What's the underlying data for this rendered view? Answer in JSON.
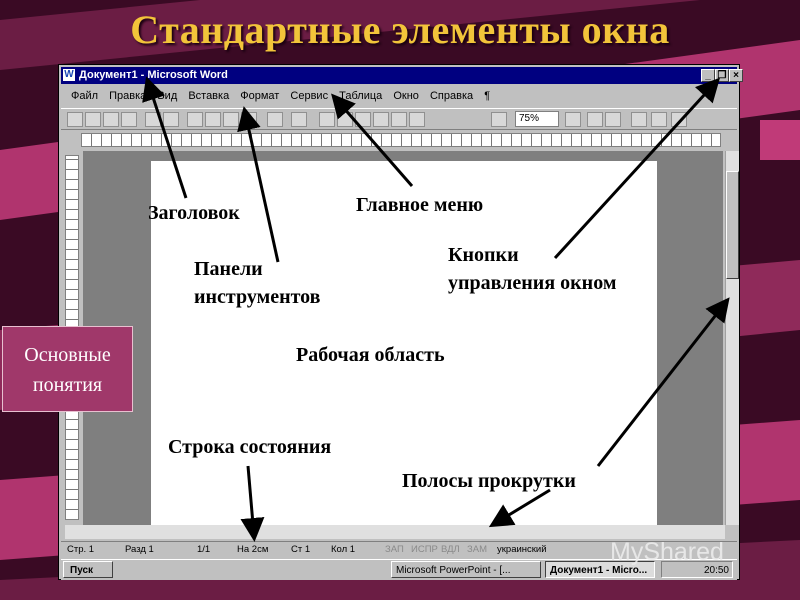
{
  "slide": {
    "title": "Стандартные элементы окна",
    "concepts_button": "Основные понятия",
    "watermark": "MyShared"
  },
  "window": {
    "title": "Документ1 - Microsoft Word",
    "app_icon": "W",
    "controls": [
      "minimize-icon",
      "restore-icon",
      "close-icon"
    ],
    "menu": [
      "Файл",
      "Правка",
      "Вид",
      "Вставка",
      "Формат",
      "Сервис",
      "Таблица",
      "Окно",
      "Справка"
    ],
    "zoom": "75%"
  },
  "statusbar": {
    "page": "Стр. 1",
    "section": "Разд 1",
    "pages": "1/1",
    "at": "На 2см",
    "line": "Ст 1",
    "col": "Кол 1",
    "modes": [
      "ЗАП",
      "ИСПР",
      "ВДЛ",
      "ЗАМ"
    ],
    "language": "украинский"
  },
  "taskbar": {
    "start": "Пуск",
    "tasks": [
      "Microsoft PowerPoint - [...",
      "Документ1 - Micro..."
    ],
    "clock": "20:50"
  },
  "labels": {
    "title_bar": "Заголовок",
    "main_menu": "Главное меню",
    "toolbars_1": "Панели",
    "toolbars_2": "инструментов",
    "window_buttons_1": "Кнопки",
    "window_buttons_2": "управления окном",
    "work_area": "Рабочая область",
    "status_bar": "Строка состояния",
    "scrollbars": "Полосы прокрутки"
  },
  "colors": {
    "title_text": "#f2c43a",
    "background": "#3a0a24",
    "stripe": "#b0346e",
    "title_bar": "#000080"
  }
}
